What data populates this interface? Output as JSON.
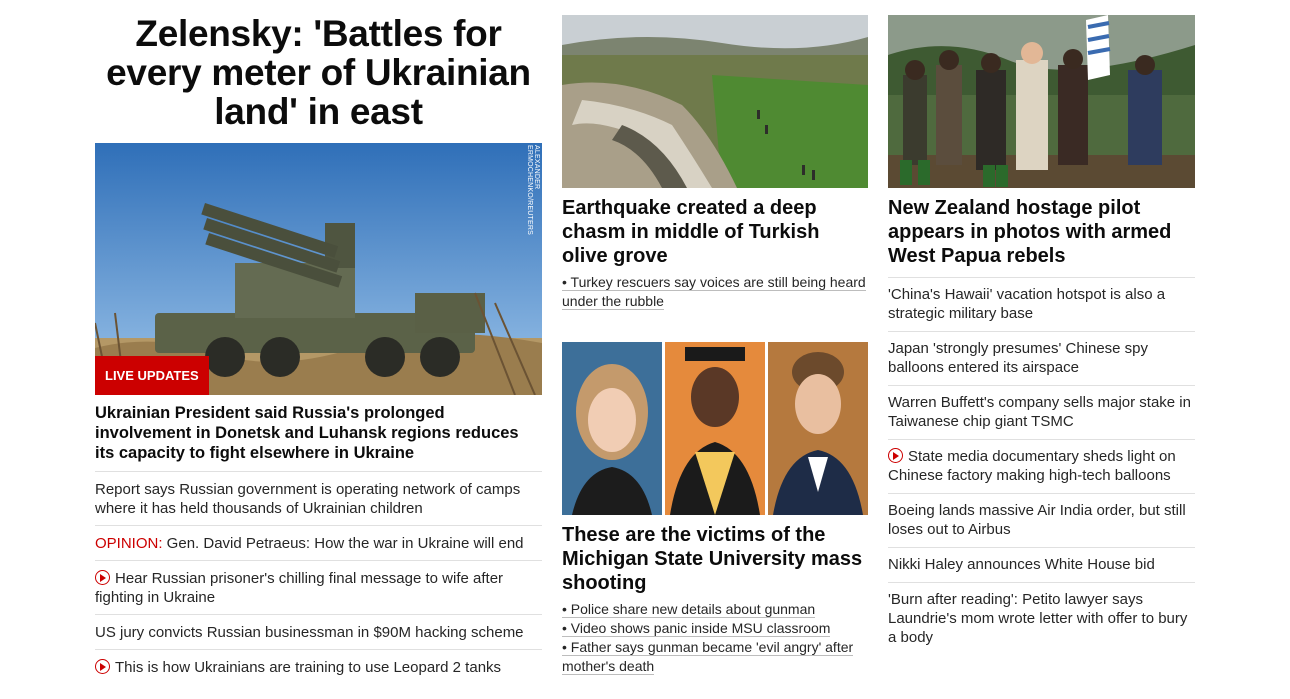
{
  "lead": {
    "headline": "Zelensky: 'Battles for every meter of Ukrainian land' in east",
    "badge": "LIVE UPDATES",
    "photo_credit": "ALEXANDER ERMOCHENKO/REUTERS",
    "summary": "Ukrainian President said Russia's prolonged involvement in Donetsk and Luhansk regions reduces its capacity to fight elsewhere in Ukraine",
    "links": [
      {
        "text": "Report says Russian government is operating network of camps where it has held thousands of Ukrainian children"
      },
      {
        "prefix": "OPINION:",
        "text": " Gen. David Petraeus: How the war in Ukraine will end"
      },
      {
        "icon": "play-icon",
        "text": "Hear Russian prisoner's chilling final message to wife after fighting in Ukraine"
      },
      {
        "text": "US jury convicts Russian businessman in $90M hacking scheme"
      },
      {
        "icon": "play-icon",
        "text": "This is how Ukrainians are training to use Leopard 2 tanks"
      }
    ]
  },
  "middle": {
    "story1": {
      "title": "Earthquake created a deep chasm in middle of Turkish olive grove",
      "bullets": [
        "• Turkey rescuers say voices are still being heard under the rubble"
      ]
    },
    "story2": {
      "title": "These are the victims of the Michigan State University mass shooting",
      "bullets": [
        "• Police share new details about gunman",
        "• Video shows panic inside MSU classroom",
        "• Father says gunman became 'evil angry' after mother's death"
      ]
    }
  },
  "right": {
    "title": "New Zealand hostage pilot appears in photos with armed West Papua rebels",
    "links": [
      {
        "text": "'China's Hawaii' vacation hotspot is also a strategic military base"
      },
      {
        "text": "Japan 'strongly presumes' Chinese spy balloons entered its airspace"
      },
      {
        "text": "Warren Buffett's company sells major stake in Taiwanese chip giant TSMC"
      },
      {
        "icon": "play-icon",
        "text": "State media documentary sheds light on Chinese factory making high-tech balloons"
      },
      {
        "text": "Boeing lands massive Air India order, but still loses out to Airbus"
      },
      {
        "text": "Nikki Haley announces White House bid"
      },
      {
        "text": "'Burn after reading': Petito lawyer says Laundrie's mom wrote letter with offer to bury a body"
      }
    ]
  },
  "colors": {
    "accent": "#cc0000",
    "text": "#0c0c0c",
    "divider": "#e0e0e0"
  }
}
